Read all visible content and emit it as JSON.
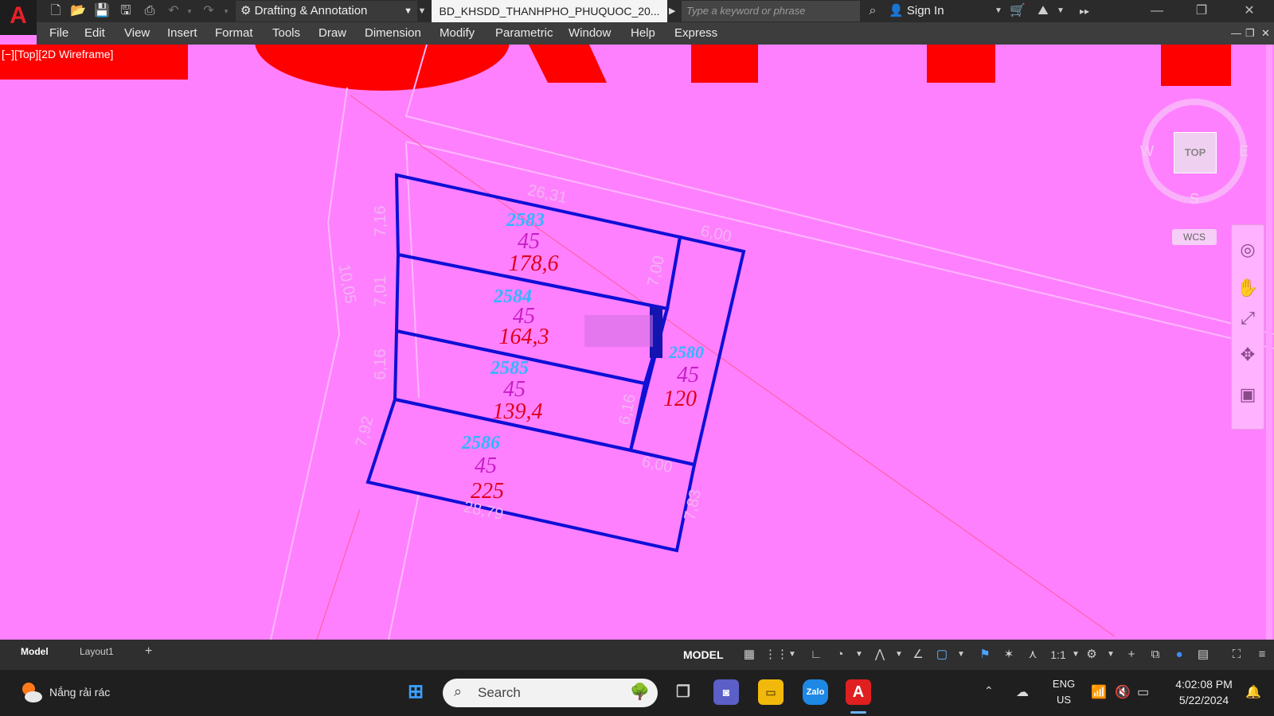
{
  "titlebar": {
    "app_logo": "A",
    "workspace": "Drafting & Annotation",
    "document_tab": "BD_KHSDD_THANHPHO_PHUQUOC_20...",
    "search_placeholder": "Type a keyword or phrase",
    "sign_in": "Sign In"
  },
  "menu": [
    "File",
    "Edit",
    "View",
    "Insert",
    "Format",
    "Tools",
    "Draw",
    "Dimension",
    "Modify",
    "Parametric",
    "Window",
    "Help",
    "Express"
  ],
  "viewport_label": "[−][Top][2D Wireframe]",
  "viewcube": {
    "top": "TOP",
    "west": "W",
    "east": "E",
    "south": "S",
    "wcs": "WCS"
  },
  "parcels": [
    {
      "id": "2583",
      "code": "45",
      "area": "178,6"
    },
    {
      "id": "2584",
      "code": "45",
      "area": "164,3"
    },
    {
      "id": "2585",
      "code": "45",
      "area": "139,4"
    },
    {
      "id": "2586",
      "code": "45",
      "area": "225"
    },
    {
      "id": "2580",
      "code": "45",
      "area": "120"
    }
  ],
  "dimensions": [
    "26,31",
    "6,00",
    "7,16",
    "7,01",
    "6,16",
    "7,92",
    "10,05",
    "7,00",
    "6,16",
    "6,00",
    "7,83",
    "28,79"
  ],
  "colors": {
    "canvas": "#ff80ff",
    "parcel_outline": "#0f0fd6",
    "parcel_id": "#2fb6ff",
    "parcel_code": "#c81ec8",
    "parcel_area": "#e0001a",
    "red_zone": "#ff0000"
  },
  "statusbar": {
    "layout_tabs": [
      "Model",
      "Layout1"
    ],
    "model": "MODEL",
    "scale": "1:1"
  },
  "taskbar": {
    "weather": "Nắng rải rác",
    "search": "Search",
    "lang_line1": "ENG",
    "lang_line2": "US",
    "time": "4:02:08 PM",
    "date": "5/22/2024"
  }
}
